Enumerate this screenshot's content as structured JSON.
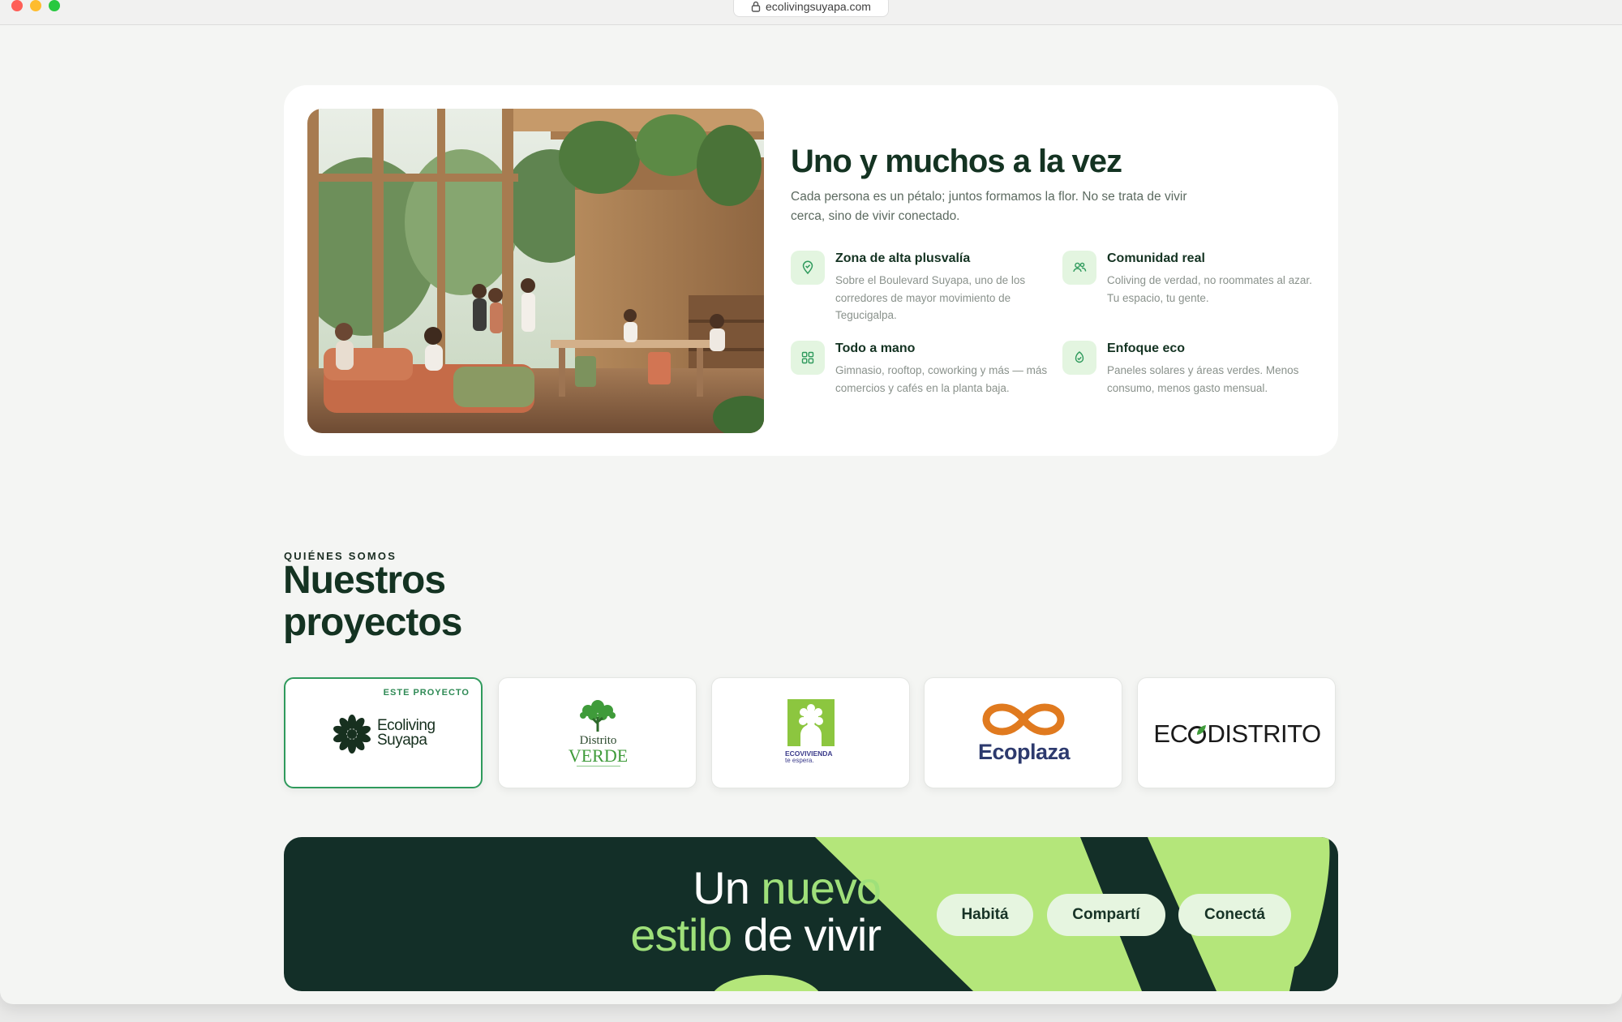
{
  "browser": {
    "url": "ecolivingsuyapa.com"
  },
  "hero": {
    "title": "Uno y muchos a la vez",
    "description": "Cada persona es un pétalo; juntos formamos la flor. No se trata de vivir cerca, sino de vivir conectado.",
    "features": [
      {
        "icon": "map-pin-icon",
        "title": "Zona de alta plusvalía",
        "description": "Sobre el Boulevard Suyapa, uno de los corredores de mayor movimiento de Tegucigalpa."
      },
      {
        "icon": "users-icon",
        "title": "Comunidad real",
        "description": "Coliving de verdad, no roommates al azar. Tu espacio, tu gente."
      },
      {
        "icon": "grid-icon",
        "title": "Todo a mano",
        "description": "Gimnasio, rooftop, coworking y más — más comercios y cafés en la planta baja."
      },
      {
        "icon": "leaf-icon",
        "title": "Enfoque eco",
        "description": "Paneles solares y áreas verdes. Menos consumo, menos gasto mensual."
      }
    ]
  },
  "projects": {
    "eyebrow": "QUIÉNES SOMOS",
    "title": "Nuestros proyectos",
    "current_badge": "ESTE PROYECTO",
    "items": [
      {
        "logo_text_line1": "Ecoliving",
        "logo_text_line2": "Suyapa"
      },
      {
        "logo_text_line1": "Distrito",
        "logo_text_line2": "VERDE"
      },
      {
        "logo_text_line1": "ECOVIVIENDA",
        "logo_text_line2": "te espera."
      },
      {
        "logo_text_line1": "Ecoplaza"
      },
      {
        "logo_text_line1": "EC",
        "logo_text_line2": "DISTRITO"
      }
    ]
  },
  "banner": {
    "title_part1": "Un",
    "title_part2": "nuevo",
    "title_part3": "estilo",
    "title_part4": "de vivir",
    "pills": [
      "Habitá",
      "Compartí",
      "Conectá"
    ]
  },
  "colors": {
    "accent_green": "#2f9a5c",
    "dark_green": "#132f28",
    "lime": "#b4e67a",
    "pill_bg": "#e6f5e0"
  }
}
